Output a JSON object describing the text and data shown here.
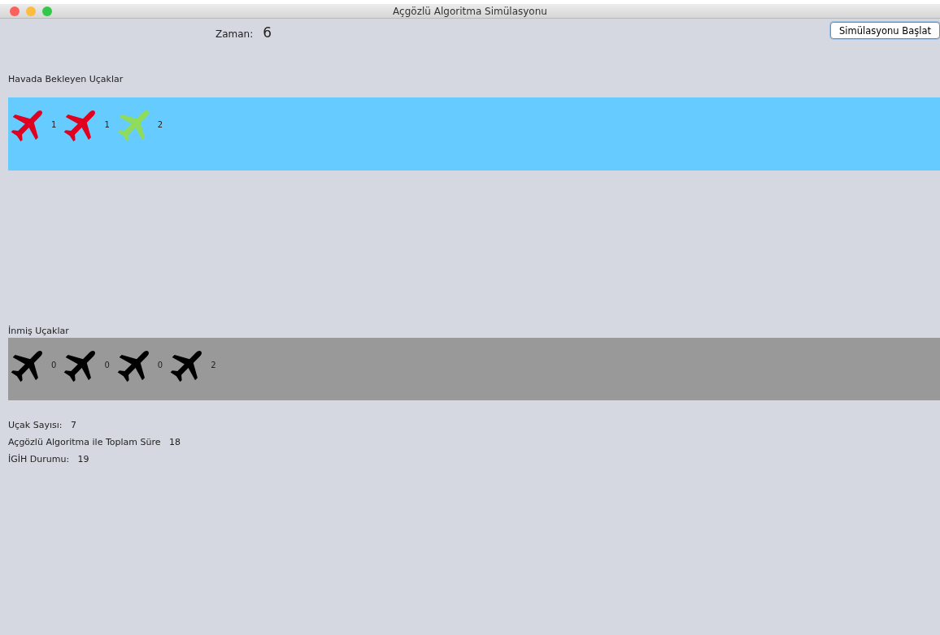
{
  "window": {
    "title": "Açgözlü Algoritma Simülasyonu"
  },
  "time": {
    "label": "Zaman:",
    "value": "6"
  },
  "start_button": "Simülasyonu Başlat",
  "waiting": {
    "title": "Havada Bekleyen Uçaklar",
    "planes": [
      {
        "color": "#e0001f",
        "count": "1"
      },
      {
        "color": "#e0001f",
        "count": "1"
      },
      {
        "color": "#8fdc5a",
        "count": "2"
      }
    ]
  },
  "landed": {
    "title": "İnmiş Uçaklar",
    "planes": [
      {
        "color": "#000000",
        "count": "0"
      },
      {
        "color": "#000000",
        "count": "0"
      },
      {
        "color": "#000000",
        "count": "0"
      },
      {
        "color": "#000000",
        "count": "2"
      }
    ]
  },
  "stats": [
    {
      "label": "Uçak Sayısı:",
      "value": "7"
    },
    {
      "label": "Açgözlü Algoritma ile Toplam Süre",
      "value": "18"
    },
    {
      "label": "İGİH Durumu:",
      "value": "19"
    }
  ]
}
